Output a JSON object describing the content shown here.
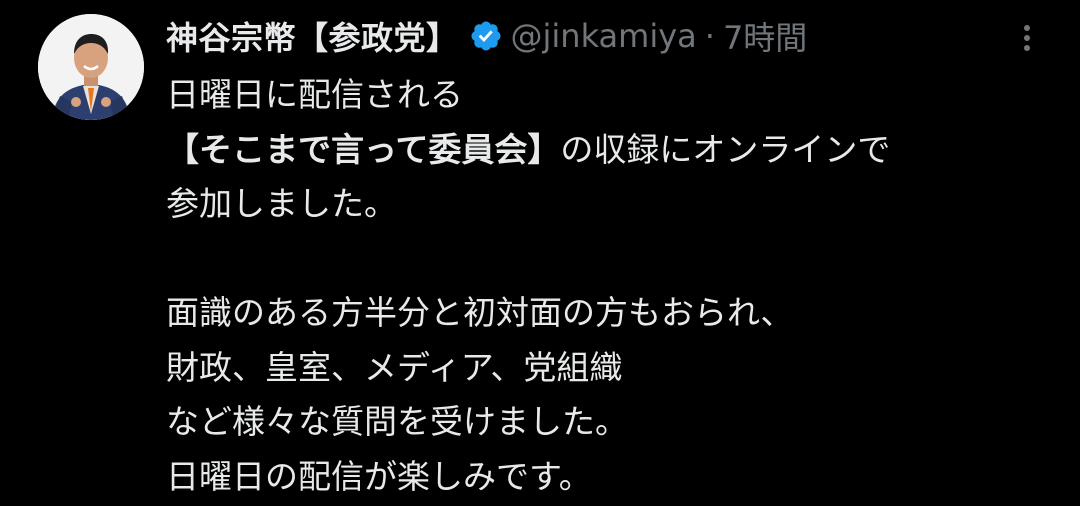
{
  "tweet": {
    "author_name": "神谷宗幣【参政党】",
    "handle": "@jinkamiya",
    "separator": "·",
    "time": "7時間",
    "verified_icon": "verified-badge-icon",
    "more_icon": "more-vertical-icon",
    "lines": [
      {
        "text": "日曜日に配信される"
      },
      {
        "bold": "【そこまで言って委員会】",
        "text": "の収録にオンラインで"
      },
      {
        "text": "参加しました。"
      },
      {
        "text": ""
      },
      {
        "text": "面識のある方半分と初対面の方もおられ、"
      },
      {
        "text": "財政、皇室、メディア、党組織"
      },
      {
        "text": "など様々な質問を受けました。"
      },
      {
        "text": "日曜日の配信が楽しみです。"
      }
    ]
  },
  "colors": {
    "background": "#000000",
    "text": "#e7e9ea",
    "secondary": "#71767b",
    "verified": "#1d9bf0"
  }
}
